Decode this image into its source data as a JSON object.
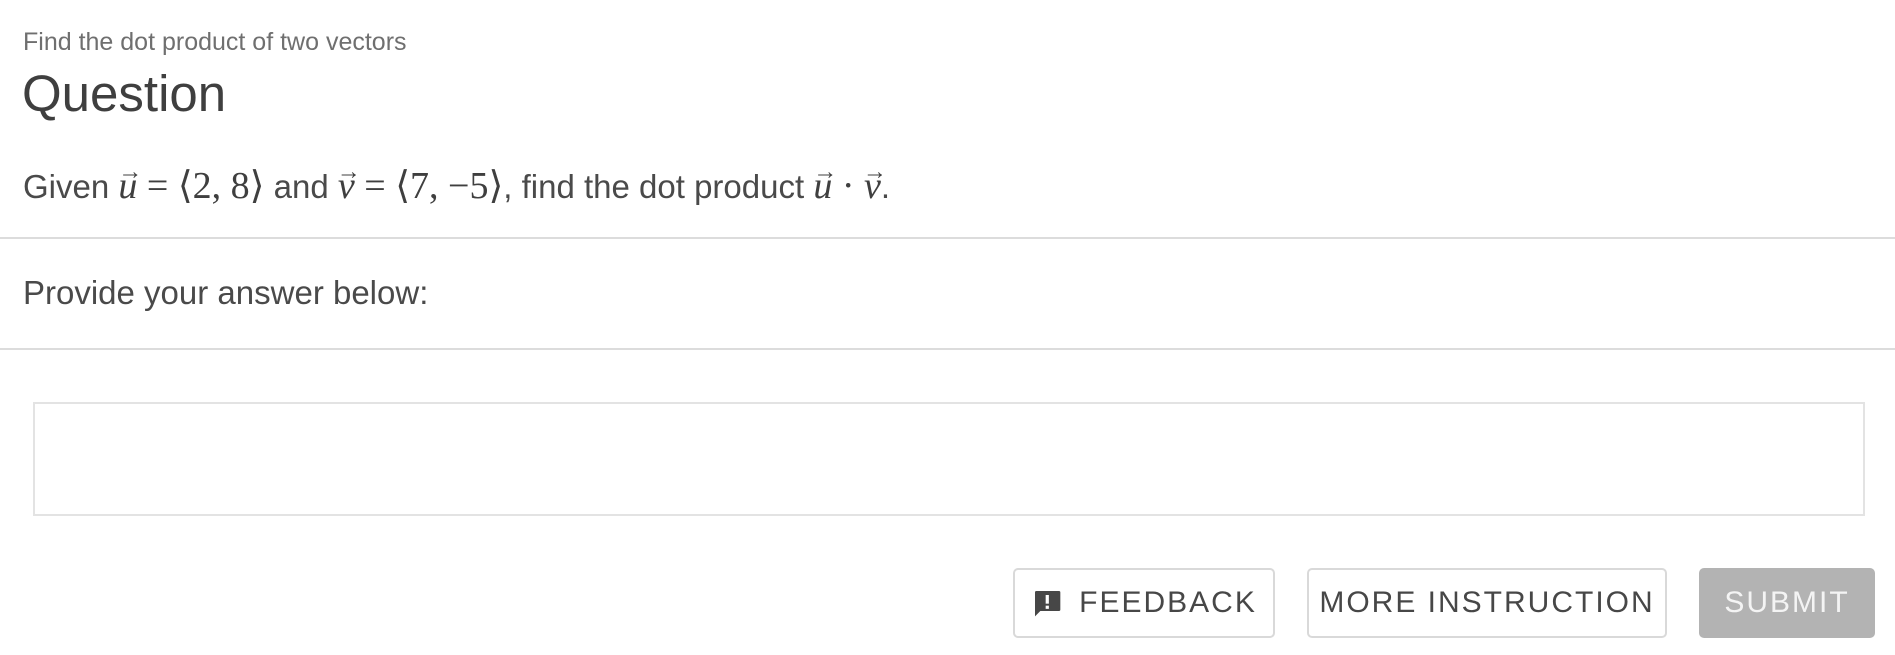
{
  "header": {
    "subtitle": "Find the dot product of two vectors",
    "title": "Question"
  },
  "question": {
    "word_given": "Given",
    "u_symbol": "u",
    "u_value": " = ⟨2, 8⟩",
    "word_and": "and",
    "v_symbol": "v",
    "v_value": " = ⟨7, −5⟩",
    "word_find": ", find the dot product",
    "product_u": "u",
    "product_dot": " · ",
    "product_v": "v",
    "period": "."
  },
  "answer": {
    "label": "Provide your answer below:",
    "value": "",
    "placeholder": ""
  },
  "actions": {
    "feedback_label": "FEEDBACK",
    "feedback_icon": "feedback-icon",
    "more_instruction_label": "MORE INSTRUCTION",
    "submit_label": "SUBMIT"
  },
  "colors": {
    "submit_disabled_bg": "#b3b3b3",
    "divider": "#dcdcdc",
    "text": "#4a4a4a"
  }
}
